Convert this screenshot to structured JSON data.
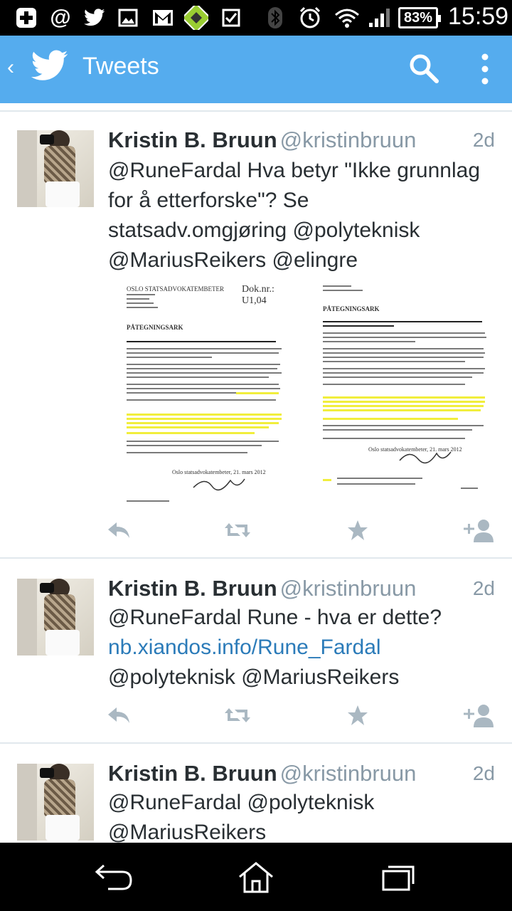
{
  "status_bar": {
    "icons": [
      "plus-app-icon",
      "at-icon",
      "twitter-notification-icon",
      "image-icon",
      "gmail-icon",
      "app-icon",
      "checkbox-icon",
      "bluetooth-icon",
      "alarm-icon",
      "wifi-icon",
      "signal-icon"
    ],
    "battery": "83%",
    "time": "15:59"
  },
  "app_bar": {
    "title": "Tweets",
    "background": "#55acee"
  },
  "tweets": [
    {
      "name": "Kristin B. Bruun",
      "handle": "@kristinbruun",
      "age": "2d",
      "text_lines": [
        "@RuneFardal Hva betyr \"Ikke grunnlag",
        "for å etterforske\"? Se",
        "statsadv.omgjøring @polyteknisk",
        "@MariusReikers @elingre"
      ],
      "doc_left": {
        "header": "OSLO STATSADVOKATEMBETER",
        "doc_no": "Dok.nr.: U1,04",
        "title": "PÅTEGNINGSARK",
        "signature": "Oslo statsadvokatembeter, 21. mars 2012"
      },
      "doc_right": {
        "title": "PÅTEGNINGSARK",
        "signature": "Oslo statsadvokatembeter, 21. mars 2012"
      }
    },
    {
      "name": "Kristin B. Bruun",
      "handle": "@kristinbruun",
      "age": "2d",
      "text_line1": "@RuneFardal Rune - hva er dette?",
      "link": "nb.xiandos.info/Rune_Fardal",
      "text_line3": "@polyteknisk @MariusReikers"
    },
    {
      "name": "Kristin B. Bruun",
      "handle": "@kristinbruun",
      "age": "2d",
      "text_lines": [
        "@RuneFardal @polyteknisk",
        "@MariusReikers"
      ]
    }
  ]
}
